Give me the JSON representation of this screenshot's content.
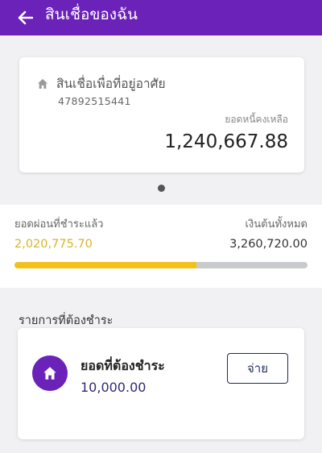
{
  "header": {
    "title": "สินเชื่อของฉัน",
    "back_icon": "arrow-left-icon",
    "background": "#6a22b8"
  },
  "loan_card": {
    "icon": "home-icon",
    "name": "สินเชื่อเพื่อที่อยู่อาศัย",
    "account_number": "47892515441",
    "balance_label": "ยอดหนี้คงเหลือ",
    "balance_value": "1,240,667.88"
  },
  "pager": {
    "pages": 1,
    "current": 1
  },
  "repayment": {
    "paid_label": "ยอดผ่อนที่ชำระแล้ว",
    "paid_value": "2,020,775.70",
    "total_label": "เงินต้นทั้งหมด",
    "total_value": "3,260,720.00",
    "progress_fraction": 0.62,
    "fill_color": "#f2c21a",
    "paid_color": "#d9b32b"
  },
  "due_section": {
    "title": "รายการที่ต้องชำระ",
    "item": {
      "icon": "home-icon",
      "label": "ยอดที่ต้องชำระ",
      "amount": "10,000.00",
      "pay_label": "จ่าย"
    }
  }
}
